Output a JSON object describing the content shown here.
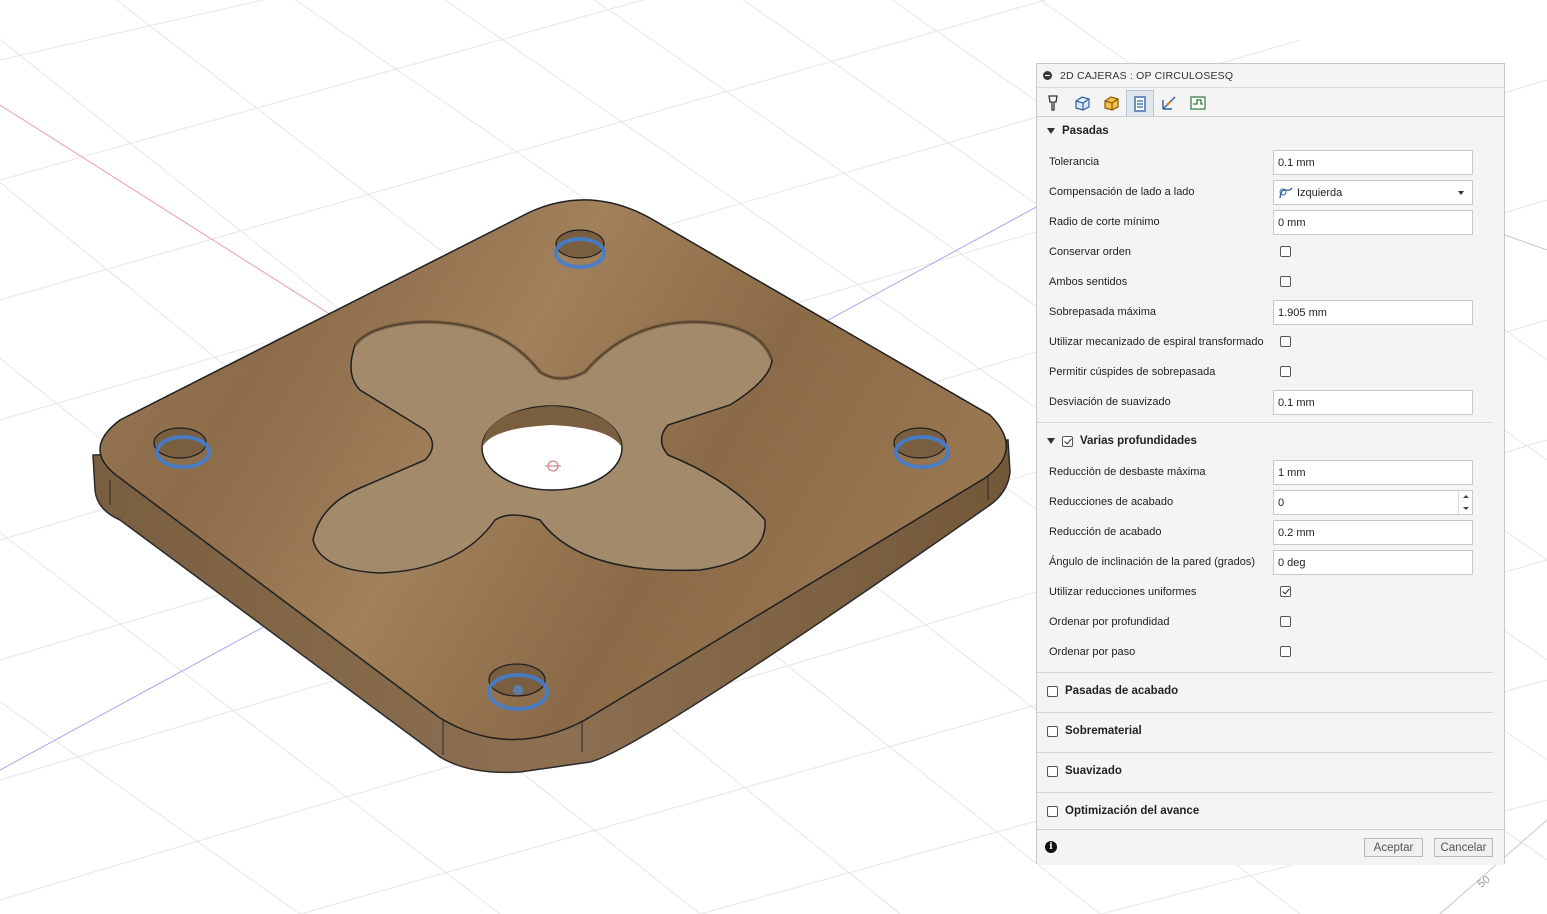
{
  "panel": {
    "title": "2D CAJERAS : OP CIRCULOSESQ",
    "tabs": [
      {
        "icon": "tool-icon"
      },
      {
        "icon": "geometry-icon"
      },
      {
        "icon": "heights-icon"
      },
      {
        "icon": "passes-icon",
        "active": true
      },
      {
        "icon": "linking-icon"
      },
      {
        "icon": "shape-icon"
      }
    ],
    "sections": {
      "pasadas": {
        "title": "Pasadas",
        "tolerancia_label": "Tolerancia",
        "tolerancia_value": "0.1 mm",
        "compensacion_label": "Compensación de lado a lado",
        "compensacion_value": "Izquierda",
        "radio_label": "Radio de corte mínimo",
        "radio_value": "0 mm",
        "conservar_label": "Conservar orden",
        "conservar_checked": false,
        "ambos_label": "Ambos sentidos",
        "ambos_checked": false,
        "sobrepasada_label": "Sobrepasada máxima",
        "sobrepasada_value": "1.905 mm",
        "espiral_label": "Utilizar mecanizado de espiral transformado",
        "espiral_checked": false,
        "cuspides_label": "Permitir cúspides de sobrepasada",
        "cuspides_checked": false,
        "desviacion_label": "Desviación de suavizado",
        "desviacion_value": "0.1 mm"
      },
      "varias": {
        "title": "Varias profundidades",
        "enabled": true,
        "reduccion_max_label": "Reducción de desbaste máxima",
        "reduccion_max_value": "1 mm",
        "reducciones_acabado_label": "Reducciones de acabado",
        "reducciones_acabado_value": "0",
        "reduccion_acabado_label": "Reducción de acabado",
        "reduccion_acabado_value": "0.2 mm",
        "angulo_label": "Ángulo de inclinación de la pared (grados)",
        "angulo_value": "0 deg",
        "uniformes_label": "Utilizar reducciones uniformes",
        "uniformes_checked": true,
        "ordenar_prof_label": "Ordenar por profundidad",
        "ordenar_prof_checked": false,
        "ordenar_paso_label": "Ordenar por paso",
        "ordenar_paso_checked": false
      },
      "pasadas_acabado": {
        "title": "Pasadas de acabado",
        "checked": false
      },
      "sobrematerial": {
        "title": "Sobrematerial",
        "checked": false
      },
      "suavizado": {
        "title": "Suavizado",
        "checked": false
      },
      "optimizacion": {
        "title": "Optimización del avance",
        "checked": false
      }
    },
    "footer": {
      "accept_label": "Aceptar",
      "cancel_label": "Cancelar"
    }
  },
  "viewport": {
    "grid_scale_label": "50"
  }
}
